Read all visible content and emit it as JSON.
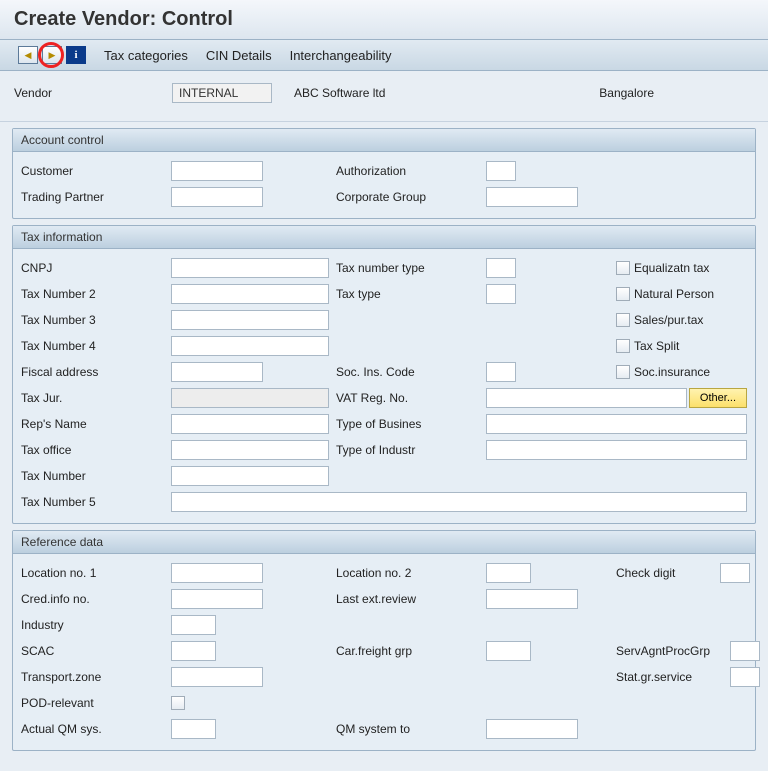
{
  "title": "Create Vendor: Control",
  "toolbar": {
    "links": [
      "Tax categories",
      "CIN Details",
      "Interchangeability"
    ]
  },
  "header": {
    "vendor_label": "Vendor",
    "vendor_value": "INTERNAL",
    "name": "ABC Software ltd",
    "location": "Bangalore"
  },
  "panels": {
    "account": {
      "title": "Account control",
      "customer": "Customer",
      "trading_partner": "Trading Partner",
      "authorization": "Authorization",
      "corporate_group": "Corporate Group"
    },
    "tax": {
      "title": "Tax information",
      "cnpj": "CNPJ",
      "tax_num2": "Tax Number 2",
      "tax_num3": "Tax Number 3",
      "tax_num4": "Tax Number 4",
      "fiscal_addr": "Fiscal address",
      "tax_jur": "Tax Jur.",
      "reps_name": "Rep's Name",
      "tax_office": "Tax office",
      "tax_number": "Tax Number",
      "tax_num5": "Tax Number 5",
      "tax_num_type": "Tax number type",
      "tax_type": "Tax type",
      "soc_ins_code": "Soc. Ins. Code",
      "vat_reg_no": "VAT Reg. No.",
      "type_of_busines": "Type of Busines",
      "type_of_industr": "Type of Industr",
      "equalizatn_tax": "Equalizatn tax",
      "natural_person": "Natural Person",
      "sales_pur_tax": "Sales/pur.tax",
      "tax_split": "Tax Split",
      "soc_insurance": "Soc.insurance",
      "other_btn": "Other..."
    },
    "reference": {
      "title": "Reference data",
      "loc1": "Location no. 1",
      "loc2": "Location no. 2",
      "check_digit": "Check digit",
      "cred_info": "Cred.info no.",
      "last_ext_review": "Last ext.review",
      "industry": "Industry",
      "scac": "SCAC",
      "car_freight": "Car.freight grp",
      "serv_agnt": "ServAgntProcGrp",
      "transport_zone": "Transport.zone",
      "stat_gr_service": "Stat.gr.service",
      "pod_relevant": "POD-relevant",
      "actual_qm": "Actual QM sys.",
      "qm_system_to": "QM system to"
    }
  }
}
